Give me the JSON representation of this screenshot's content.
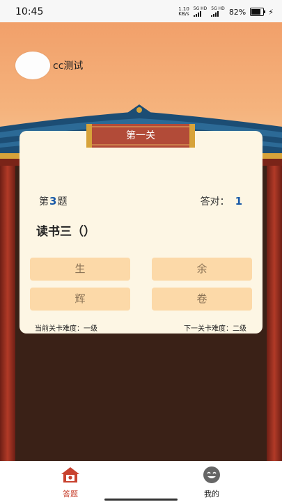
{
  "status_bar": {
    "time": "10:45",
    "net_speed_value": "1.10",
    "net_speed_unit": "KB/s",
    "signal1_label": "5G HD",
    "signal2_label": "5G HD",
    "battery_text": "82%",
    "battery_level": 0.82
  },
  "user": {
    "name": "cc测试"
  },
  "level": {
    "title": "第一关"
  },
  "question": {
    "prefix": "第",
    "number": "3",
    "suffix": "题",
    "correct_label": "答对：",
    "correct_count": "1",
    "text": "读书三（）"
  },
  "options": [
    "生",
    "余",
    "辉",
    "卷"
  ],
  "difficulty": {
    "current": "当前关卡难度：一级",
    "next": "下一关卡难度：二级"
  },
  "nav": {
    "answer_label": "答题",
    "mine_label": "我的"
  },
  "colors": {
    "accent": "#c8422f",
    "number_blue": "#1a5aa8",
    "option_bg": "#fcd9a8",
    "card_bg": "#fdf6e4"
  }
}
